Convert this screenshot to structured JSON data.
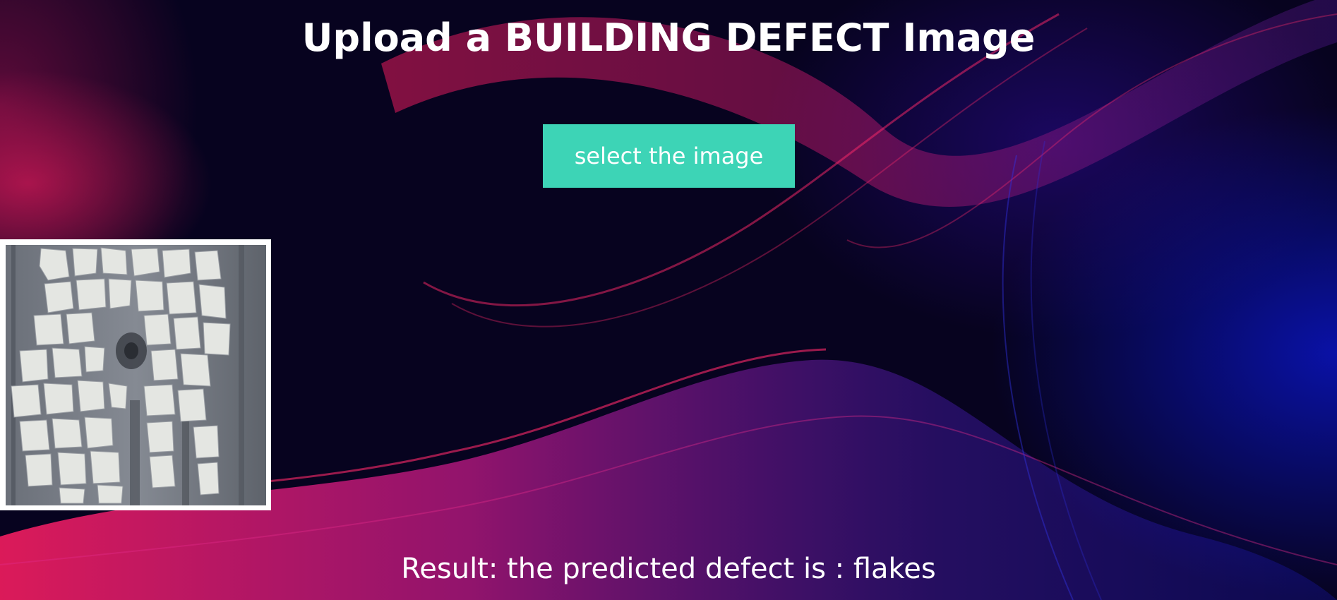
{
  "page": {
    "title": "Upload a BUILDING DEFECT Image"
  },
  "upload": {
    "button_label": "select the image"
  },
  "preview": {
    "icon": "peeling-paint-photo"
  },
  "result": {
    "text": "Result: the predicted defect is : flakes"
  },
  "colors": {
    "button": "#3dd4b6",
    "background": "#07031f",
    "accent_pink": "#ff1e63",
    "accent_blue": "#0a14be",
    "text": "#ffffff"
  }
}
